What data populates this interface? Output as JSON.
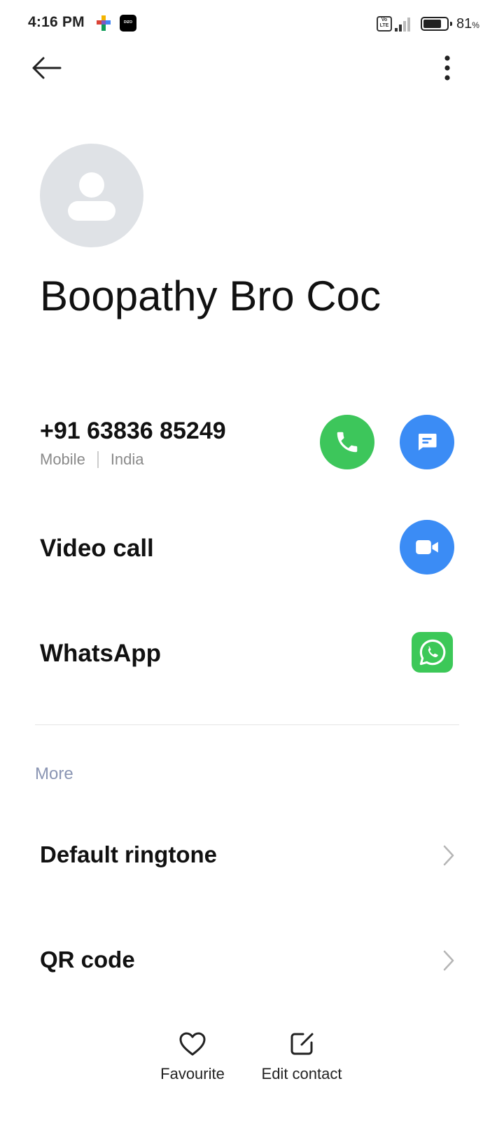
{
  "status_bar": {
    "time": "4:16 PM",
    "app_badge": "DIZO",
    "network_badge": "Vo LTE",
    "battery_level": 0.81,
    "battery_percent": "81",
    "battery_unit": "%"
  },
  "header": {
    "back_icon": "arrow-left-icon",
    "menu_icon": "more-vertical-icon"
  },
  "contact": {
    "name": "Boopathy Bro Coc",
    "avatar_icon": "person-placeholder-icon",
    "phone": {
      "number": "+91 63836 85249",
      "type": "Mobile",
      "region": "India"
    }
  },
  "actions": {
    "video_call_label": "Video call",
    "whatsapp_label": "WhatsApp"
  },
  "more_section": {
    "title": "More",
    "items": [
      {
        "label": "Default ringtone"
      },
      {
        "label": "QR code"
      }
    ]
  },
  "bottom_bar": {
    "favourite_label": "Favourite",
    "edit_label": "Edit contact"
  },
  "colors": {
    "call_green": "#3dc65b",
    "action_blue": "#3b8cf5",
    "whatsapp_green": "#3cc858",
    "section_title": "#8a95b3",
    "avatar_bg": "#dfe2e6"
  }
}
